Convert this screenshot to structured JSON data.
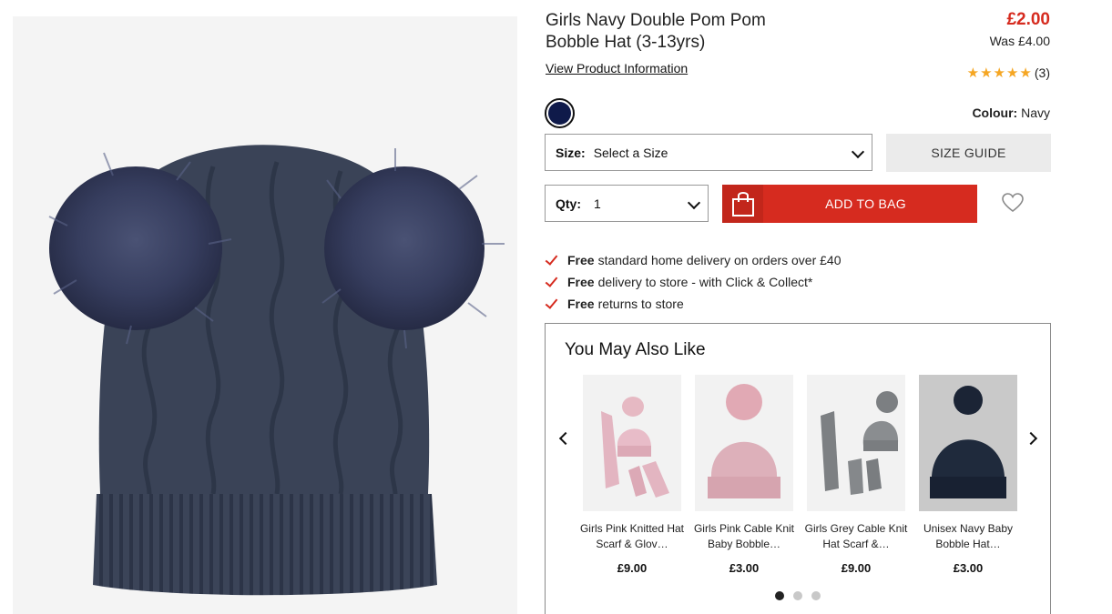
{
  "product": {
    "title": "Girls Navy Double Pom Pom Bobble Hat (3-13yrs)",
    "price": "£2.00",
    "was_price": "Was £4.00",
    "view_info": "View Product Information",
    "stars": "★★★★★",
    "review_count": "(3)",
    "colour_label": "Colour:",
    "colour_value": "Navy",
    "swatch_color": "#0f1a4a"
  },
  "size": {
    "label": "Size:",
    "value": "Select a Size",
    "guide": "SIZE GUIDE"
  },
  "qty": {
    "label": "Qty:",
    "value": "1"
  },
  "add_to_bag": "ADD TO BAG",
  "delivery": [
    {
      "bold": "Free",
      "text": "standard home delivery on orders over £40"
    },
    {
      "bold": "Free",
      "text": "delivery to store - with Click & Collect*"
    },
    {
      "bold": "Free",
      "text": "returns to store"
    }
  ],
  "recommendations": {
    "title": "You May Also Like",
    "items": [
      {
        "name": "Girls Pink Knitted Hat Scarf & Glov…",
        "price": "£9.00"
      },
      {
        "name": "Girls Pink Cable Knit Baby Bobble…",
        "price": "£3.00"
      },
      {
        "name": "Girls Grey Cable Knit Hat Scarf &…",
        "price": "£9.00"
      },
      {
        "name": "Unisex Navy Baby Bobble Hat…",
        "price": "£3.00"
      }
    ]
  },
  "colors": {
    "accent": "#d62b1f",
    "star": "#f5a623"
  }
}
